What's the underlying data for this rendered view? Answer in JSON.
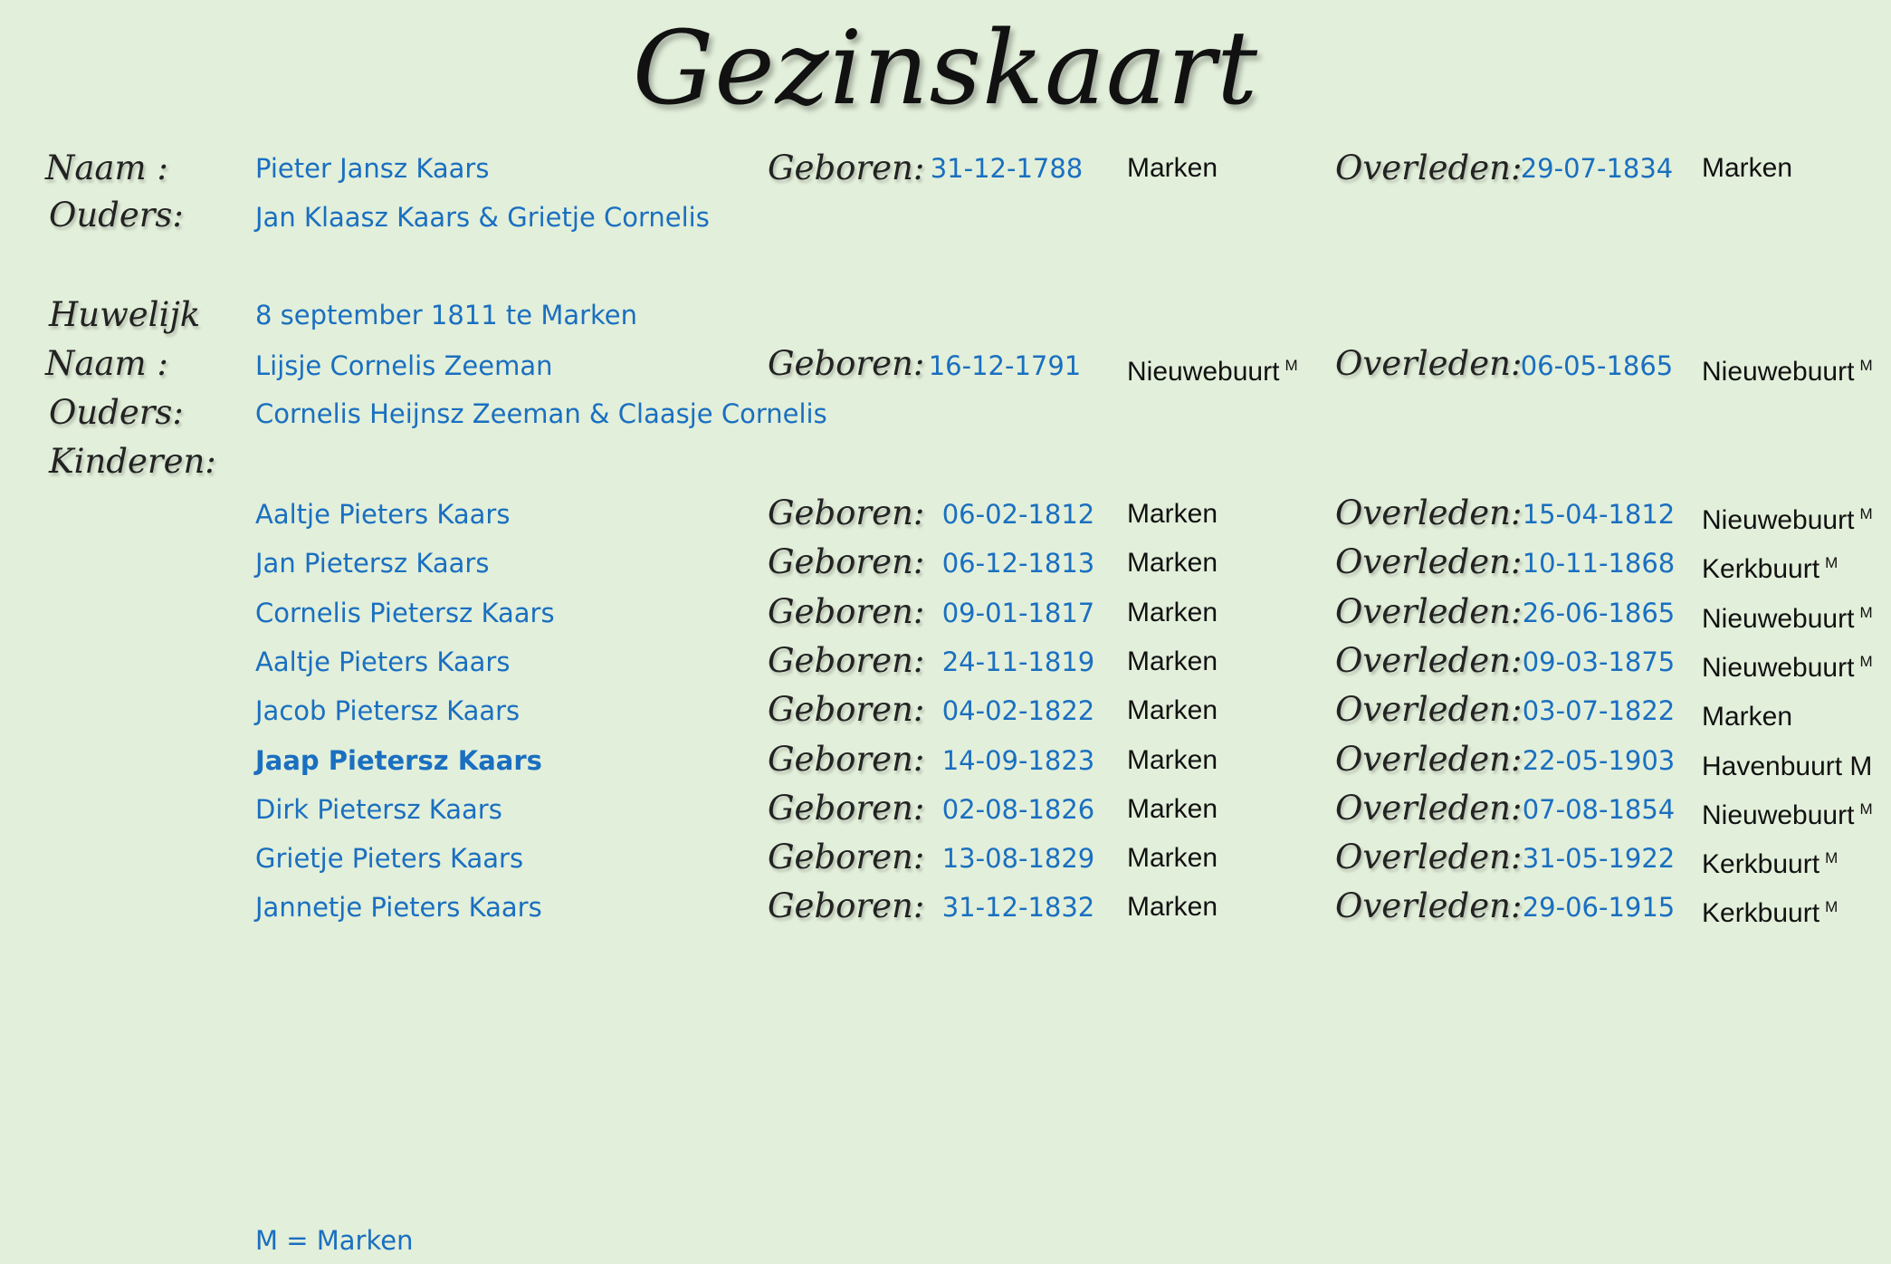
{
  "title": "Gezinskaart",
  "labels": {
    "naam": "Naam :",
    "ouders": "Ouders:",
    "huwelijk": "Huwelijk",
    "kinderen": "Kinderen:",
    "geboren": "Geboren:",
    "overleden": "Overleden:"
  },
  "husband": {
    "name": "Pieter Jansz Kaars",
    "born_date": "31-12-1788",
    "born_place": "Marken",
    "born_sup": "",
    "died_date": "29-07-1834",
    "died_place": "Marken",
    "died_sup": "",
    "parents": "Jan Klaasz Kaars & Grietje Cornelis"
  },
  "marriage": "8 september 1811 te Marken",
  "wife": {
    "name": "Lijsje Cornelis Zeeman",
    "born_date": "16-12-1791",
    "born_place": "Nieuwebuurt",
    "born_sup": "M",
    "died_date": "06-05-1865",
    "died_place": "Nieuwebuurt",
    "died_sup": "M",
    "parents": "Cornelis Heijnsz Zeeman & Claasje Cornelis"
  },
  "children": [
    {
      "name": "Aaltje Pieters Kaars",
      "bold": false,
      "born_date": "06-02-1812",
      "born_place": "Marken",
      "died_date": "15-04-1812",
      "died_place": "Nieuwebuurt",
      "died_sup": "M"
    },
    {
      "name": "Jan Pietersz Kaars",
      "bold": false,
      "born_date": "06-12-1813",
      "born_place": "Marken",
      "died_date": "10-11-1868",
      "died_place": "Kerkbuurt",
      "died_sup": "M"
    },
    {
      "name": "Cornelis Pietersz Kaars",
      "bold": false,
      "born_date": "09-01-1817",
      "born_place": "Marken",
      "died_date": "26-06-1865",
      "died_place": "Nieuwebuurt",
      "died_sup": "M"
    },
    {
      "name": "Aaltje Pieters Kaars",
      "bold": false,
      "born_date": "24-11-1819",
      "born_place": "Marken",
      "died_date": "09-03-1875",
      "died_place": "Nieuwebuurt",
      "died_sup": "M"
    },
    {
      "name": "Jacob Pietersz Kaars",
      "bold": false,
      "born_date": "04-02-1822",
      "born_place": "Marken",
      "died_date": "03-07-1822",
      "died_place": "Marken",
      "died_sup": ""
    },
    {
      "name": "Jaap Pietersz Kaars",
      "bold": true,
      "born_date": "14-09-1823",
      "born_place": "Marken",
      "died_date": "22-05-1903",
      "died_place": "Havenbuurt M",
      "died_sup": ""
    },
    {
      "name": "Dirk Pietersz Kaars",
      "bold": false,
      "born_date": "02-08-1826",
      "born_place": "Marken",
      "died_date": "07-08-1854",
      "died_place": "Nieuwebuurt",
      "died_sup": "M"
    },
    {
      "name": "Grietje Pieters Kaars",
      "bold": false,
      "born_date": "13-08-1829",
      "born_place": "Marken",
      "died_date": "31-05-1922",
      "died_place": "Kerkbuurt",
      "died_sup": "M"
    },
    {
      "name": "Jannetje Pieters Kaars",
      "bold": false,
      "born_date": "31-12-1832",
      "born_place": "Marken",
      "died_date": "29-06-1915",
      "died_place": "Kerkbuurt",
      "died_sup": "M"
    }
  ],
  "legend": "M = Marken"
}
